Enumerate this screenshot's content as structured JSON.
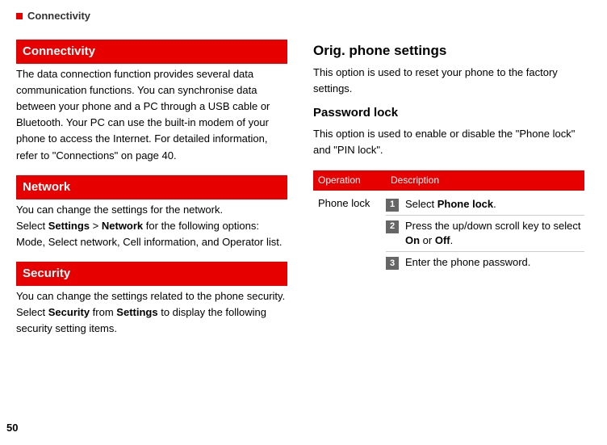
{
  "header": {
    "title": "Connectivity"
  },
  "left": {
    "sections": [
      {
        "title": "Connectivity",
        "text": "The data connection function provides several data communication functions. You can synchronise data between your phone and a PC through a USB cable or Bluetooth. Your PC can use the built-in modem of your phone to access the Internet. For detailed information, refer to \"Connections\" on page  40."
      },
      {
        "title": "Network",
        "intro": "You can change the settings for the network.",
        "line_prefix": "Select ",
        "bold1": "Settings",
        "gt": " > ",
        "bold2": "Network",
        "line_suffix": " for the following options: Mode, Select network, Cell information, and Operator list."
      },
      {
        "title": "Security",
        "intro": "You can change the settings related to the phone security.",
        "line_prefix": "Select ",
        "bold1": "Security",
        "mid": " from ",
        "bold2": "Settings",
        "line_suffix": " to display the following security setting items."
      }
    ]
  },
  "right": {
    "h1": "Orig. phone settings",
    "p1": "This option is used to reset your phone to the factory settings.",
    "h2": "Password lock",
    "p2": "This option is used to enable or disable the \"Phone lock\" and \"PIN lock\".",
    "table": {
      "header1": "Operation",
      "header2": "Description",
      "leftcell": "Phone lock",
      "steps": [
        {
          "num": "1",
          "pre": "Select ",
          "bold": "Phone lock",
          "post": "."
        },
        {
          "num": "2",
          "pre": "Press the up/down scroll key to select ",
          "bold": "On",
          "mid": " or ",
          "bold2": "Off",
          "post": "."
        },
        {
          "num": "3",
          "pre": "Enter the phone password.",
          "bold": "",
          "post": ""
        }
      ]
    }
  },
  "pageNumber": "50"
}
